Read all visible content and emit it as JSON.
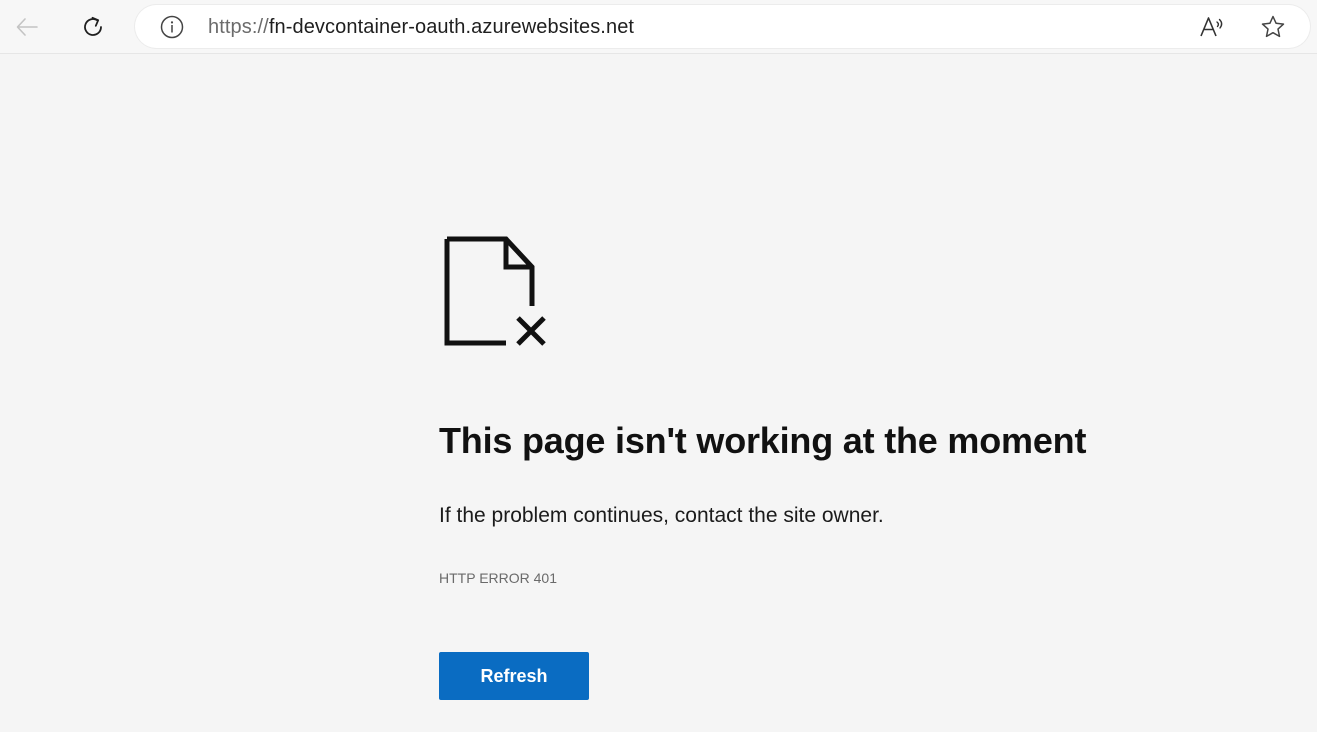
{
  "browser": {
    "url_scheme": "https://",
    "url_host": "fn-devcontainer-oauth.azurewebsites.net",
    "icons": {
      "back": "arrow-left-icon",
      "reload": "reload-icon",
      "site_info": "info-icon",
      "read_aloud": "read-aloud-icon",
      "favorite": "star-icon"
    }
  },
  "page": {
    "title": "This page isn't working at the moment",
    "message": "If the problem continues, contact the site owner.",
    "error_code": "HTTP ERROR 401",
    "refresh_label": "Refresh",
    "icon": "broken-document-icon"
  },
  "colors": {
    "background": "#f5f5f5",
    "button": "#0a6cc2",
    "button_text": "#ffffff"
  }
}
